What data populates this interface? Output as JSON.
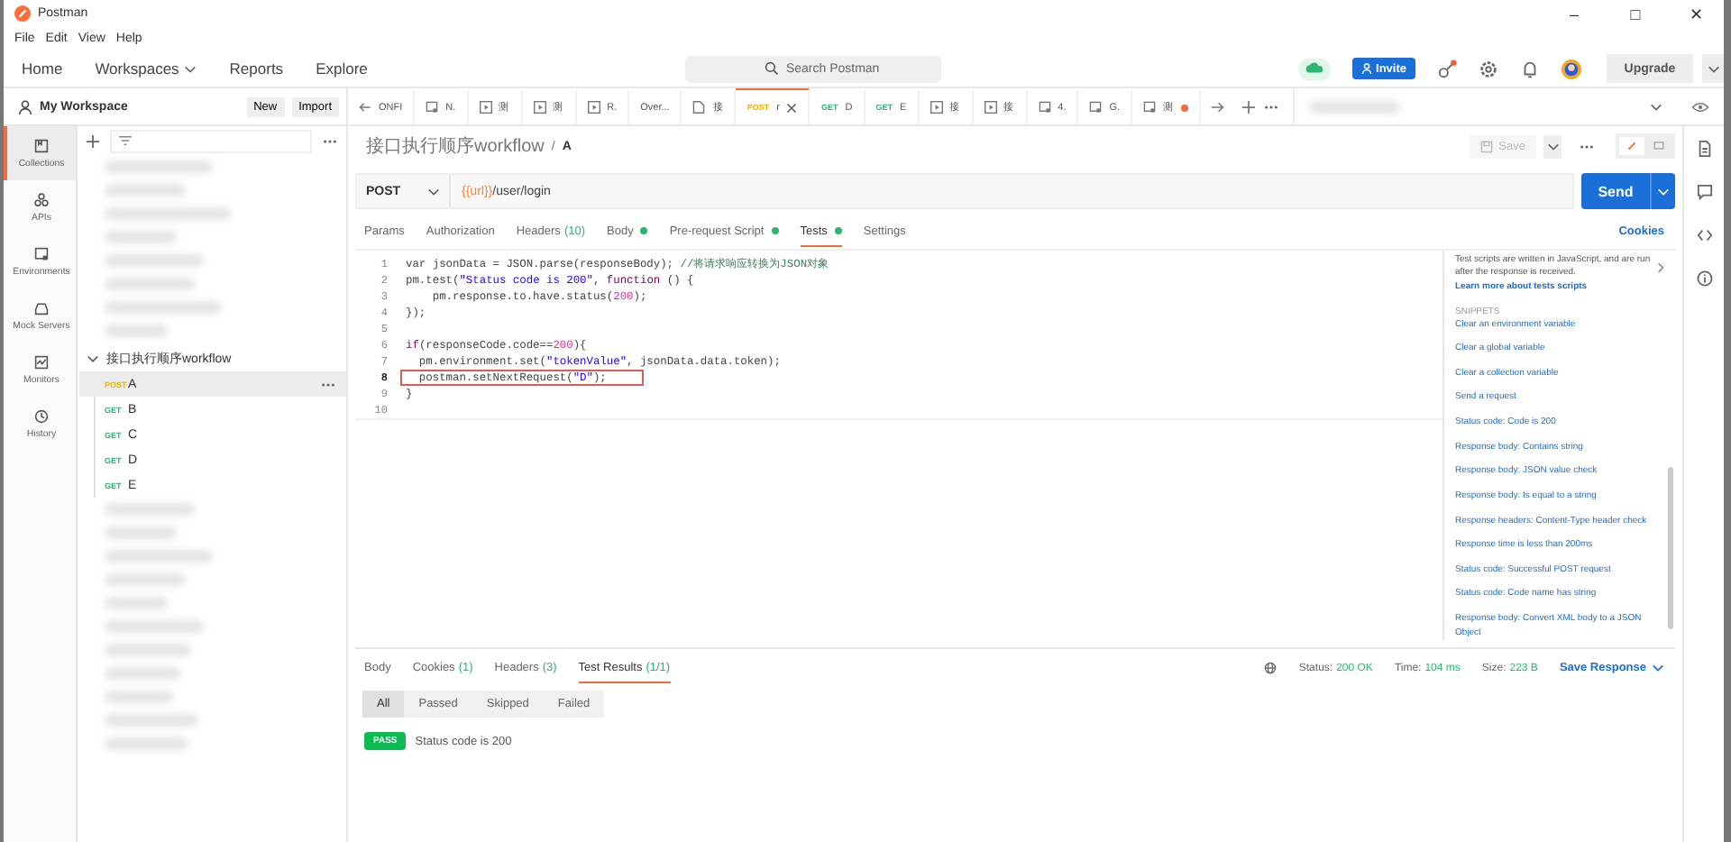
{
  "window": {
    "title": "Postman",
    "controls": [
      "–",
      "□",
      "✕"
    ]
  },
  "menu": [
    "File",
    "Edit",
    "View",
    "Help"
  ],
  "nav": {
    "items": [
      {
        "label": "Home",
        "dropdown": false
      },
      {
        "label": "Workspaces",
        "dropdown": true
      },
      {
        "label": "Reports",
        "dropdown": false
      },
      {
        "label": "Explore",
        "dropdown": false
      }
    ],
    "search": {
      "placeholder": "Search Postman"
    },
    "invite": "Invite",
    "upgrade": "Upgrade"
  },
  "workspace": {
    "name": "My Workspace",
    "buttons": [
      "New",
      "Import"
    ]
  },
  "rail": [
    {
      "label": "Collections",
      "selected": true,
      "kind": "collections"
    },
    {
      "label": "APIs",
      "selected": false,
      "kind": "apis"
    },
    {
      "label": "Environments",
      "selected": false,
      "kind": "environments"
    },
    {
      "label": "Mock Servers",
      "selected": false,
      "kind": "mock"
    },
    {
      "label": "Monitors",
      "selected": false,
      "kind": "monitors"
    },
    {
      "label": "History",
      "selected": false,
      "kind": "history"
    }
  ],
  "collection": {
    "name": "接口执行顺序workflow",
    "expanded": true,
    "requests": [
      {
        "method": "POST",
        "name": "A",
        "selected": true
      },
      {
        "method": "GET",
        "name": "B",
        "selected": false
      },
      {
        "method": "GET",
        "name": "C",
        "selected": false
      },
      {
        "method": "GET",
        "name": "D",
        "selected": false
      },
      {
        "method": "GET",
        "name": "E",
        "selected": false
      }
    ]
  },
  "open_tabs": [
    {
      "kind": "back",
      "label": "ONFI",
      "selected": false,
      "unsaved": false
    },
    {
      "kind": "env",
      "label": "N.",
      "selected": false,
      "unsaved": false
    },
    {
      "kind": "run",
      "label": "测",
      "selected": false,
      "unsaved": false
    },
    {
      "kind": "run",
      "label": "测",
      "selected": false,
      "unsaved": false
    },
    {
      "kind": "run",
      "label": "R.",
      "selected": false,
      "unsaved": false
    },
    {
      "kind": "plain",
      "label": "Over...",
      "selected": false,
      "unsaved": false
    },
    {
      "kind": "doc",
      "label": "接",
      "selected": false,
      "unsaved": false
    },
    {
      "kind": "request",
      "method": "POST",
      "label": "r",
      "selected": true,
      "unsaved": false
    },
    {
      "kind": "request",
      "method": "GET",
      "label": "D",
      "selected": false,
      "unsaved": false
    },
    {
      "kind": "request",
      "method": "GET",
      "label": "E",
      "selected": false,
      "unsaved": false
    },
    {
      "kind": "run",
      "label": "接",
      "selected": false,
      "unsaved": false
    },
    {
      "kind": "run",
      "label": "接",
      "selected": false,
      "unsaved": false
    },
    {
      "kind": "env",
      "label": "4.",
      "selected": false,
      "unsaved": false
    },
    {
      "kind": "env",
      "label": "G.",
      "selected": false,
      "unsaved": false
    },
    {
      "kind": "env",
      "label": "测",
      "selected": false,
      "unsaved": true
    }
  ],
  "breadcrumb": {
    "parent": "接口执行顺序workflow",
    "separator": "/",
    "current": "A",
    "save": "Save"
  },
  "request": {
    "method": "POST",
    "url_variable": "{{url}}",
    "url_path": "/user/login",
    "send": "Send"
  },
  "request_tabs": [
    {
      "label": "Params",
      "dot": false,
      "selected": false
    },
    {
      "label": "Authorization",
      "dot": false,
      "selected": false
    },
    {
      "label": "Headers",
      "count": "(10)",
      "dot": false,
      "selected": false
    },
    {
      "label": "Body",
      "dot": true,
      "selected": false
    },
    {
      "label": "Pre-request Script",
      "dot": true,
      "selected": false
    },
    {
      "label": "Tests",
      "dot": true,
      "selected": true
    },
    {
      "label": "Settings",
      "dot": false,
      "selected": false
    }
  ],
  "cookies": "Cookies",
  "code": [
    {
      "number": "1",
      "highlighted": false,
      "segments": [
        {
          "kind": "plain",
          "text": "var jsonData = JSON.parse(responseBody); "
        },
        {
          "kind": "comment",
          "text": "//将请求响应转换为JSON对象"
        }
      ]
    },
    {
      "number": "2",
      "highlighted": false,
      "segments": [
        {
          "kind": "plain",
          "text": "pm.test("
        },
        {
          "kind": "string",
          "text": "\"Status code is 200\""
        },
        {
          "kind": "plain",
          "text": ", "
        },
        {
          "kind": "keyword",
          "text": "function"
        },
        {
          "kind": "plain",
          "text": " () {"
        }
      ]
    },
    {
      "number": "3",
      "highlighted": false,
      "segments": [
        {
          "kind": "plain",
          "text": "    pm.response.to.have.status("
        },
        {
          "kind": "number",
          "text": "200"
        },
        {
          "kind": "plain",
          "text": ");"
        }
      ]
    },
    {
      "number": "4",
      "highlighted": false,
      "segments": [
        {
          "kind": "plain",
          "text": "});"
        }
      ]
    },
    {
      "number": "5",
      "highlighted": false
    },
    {
      "number": "6",
      "highlighted": false,
      "segments": [
        {
          "kind": "keyword",
          "text": "if"
        },
        {
          "kind": "plain",
          "text": "(responseCode.code=="
        },
        {
          "kind": "number",
          "text": "200"
        },
        {
          "kind": "plain",
          "text": "){"
        }
      ]
    },
    {
      "number": "7",
      "highlighted": false,
      "segments": [
        {
          "kind": "plain",
          "text": "  pm.environment.set("
        },
        {
          "kind": "string",
          "text": "\"tokenValue\""
        },
        {
          "kind": "plain",
          "text": ", jsonData.data.token);"
        }
      ]
    },
    {
      "number": "8",
      "highlighted": true,
      "segments": [
        {
          "kind": "plain",
          "text": "  postman.setNextRequest("
        },
        {
          "kind": "string",
          "text": "\"D\""
        },
        {
          "kind": "plain",
          "text": ");"
        }
      ]
    },
    {
      "number": "9",
      "highlighted": false,
      "segments": [
        {
          "kind": "plain",
          "text": "}"
        }
      ]
    },
    {
      "number": "10",
      "highlighted": false
    }
  ],
  "snippets_panel": {
    "intro": "Test scripts are written in JavaScript, and are run after the response is received.",
    "learn_link": "Learn more about tests scripts",
    "heading": "SNIPPETS",
    "items": [
      "Clear an environment variable",
      "Clear a global variable",
      "Clear a collection variable",
      "Send a request",
      "Status code: Code is 200",
      "Response body: Contains string",
      "Response body: JSON value check",
      "Response body: Is equal to a string",
      "Response headers: Content-Type header check",
      "Response time is less than 200ms",
      "Status code: Successful POST request",
      "Status code: Code name has string",
      "Response body: Convert XML body to a JSON Object"
    ]
  },
  "response_tabs": [
    {
      "label": "Body",
      "selected": false
    },
    {
      "label": "Cookies",
      "count": "(1)",
      "selected": false
    },
    {
      "label": "Headers",
      "count": "(3)",
      "selected": false
    },
    {
      "label": "Test Results",
      "count": "(1/1)",
      "selected": true
    }
  ],
  "response_meta": {
    "status_label": "Status:",
    "status": "200 OK",
    "time_label": "Time:",
    "time": "104 ms",
    "size_label": "Size:",
    "size": "223 B",
    "save": "Save Response"
  },
  "filters": [
    {
      "label": "All",
      "selected": true
    },
    {
      "label": "Passed",
      "selected": false
    },
    {
      "label": "Skipped",
      "selected": false
    },
    {
      "label": "Failed",
      "selected": false
    }
  ],
  "results": [
    {
      "result": "PASS",
      "name": "Status code is 200"
    }
  ]
}
